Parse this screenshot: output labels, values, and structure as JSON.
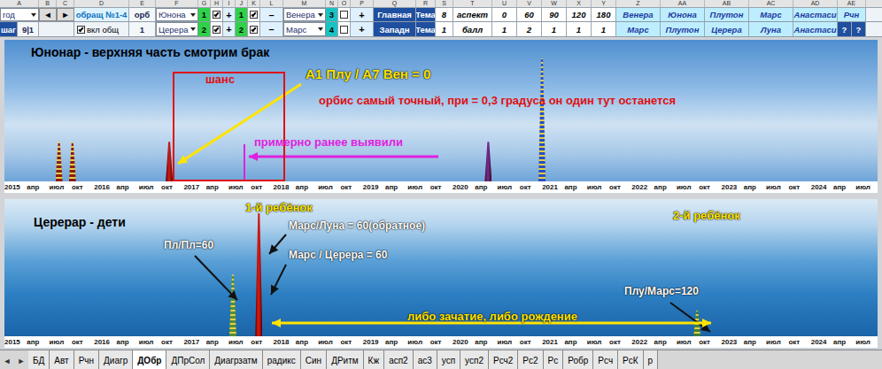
{
  "sheet": {
    "column_letters": [
      "A",
      "B",
      "C",
      "D",
      "E",
      "F",
      "G",
      "H",
      "I",
      "J",
      "K",
      "L",
      "M",
      "N",
      "O",
      "P",
      "Q",
      "R",
      "S",
      "T",
      "U",
      "V",
      "W",
      "X",
      "Y",
      "Z",
      "AA",
      "AB",
      "AC",
      "AD",
      "AE"
    ],
    "rows": [
      [
        {
          "kind": "dropdown",
          "text": "год"
        },
        {
          "kind": "button",
          "text": "◄"
        },
        {
          "kind": "button",
          "text": "►"
        },
        {
          "kind": "accent",
          "text": "обращ №1-4"
        },
        {
          "kind": "label",
          "text": "орб"
        },
        {
          "kind": "dropdown",
          "text": "Юнона"
        },
        {
          "kind": "num",
          "text": "1",
          "color": "#2fd14a"
        },
        {
          "kind": "check",
          "checked": true
        },
        {
          "kind": "sign",
          "text": "+"
        },
        {
          "kind": "num",
          "text": "1",
          "color": "#2fd14a"
        },
        {
          "kind": "check",
          "checked": true
        },
        {
          "kind": "sign",
          "text": "–"
        },
        {
          "kind": "dropdown",
          "text": "Венера"
        },
        {
          "kind": "num",
          "text": "3",
          "color": "#19c3c3"
        },
        {
          "kind": "check",
          "checked": false
        },
        {
          "kind": "sign",
          "text": "+"
        },
        {
          "kind": "head",
          "text": "Главная"
        },
        {
          "kind": "head",
          "text": "Тема"
        },
        {
          "kind": "value",
          "text": "8"
        },
        {
          "kind": "value",
          "text": "аспект"
        },
        {
          "kind": "aspect",
          "text": "0"
        },
        {
          "kind": "aspect",
          "text": "60"
        },
        {
          "kind": "aspect",
          "text": "90"
        },
        {
          "kind": "aspect",
          "text": "120"
        },
        {
          "kind": "aspect",
          "text": "180"
        },
        {
          "kind": "planet",
          "text": "Венера"
        },
        {
          "kind": "planet",
          "text": "Юнона"
        },
        {
          "kind": "planet",
          "text": "Плутон"
        },
        {
          "kind": "planet",
          "text": "Марс"
        },
        {
          "kind": "planet",
          "text": "Анастаси"
        },
        {
          "kind": "planet",
          "text": "Рчн"
        }
      ],
      [
        {
          "kind": "head",
          "text": "шаг"
        },
        {
          "kind": "label",
          "text": "9|1"
        },
        {
          "kind": "blank"
        },
        {
          "kind": "checklabel",
          "text": "вкл общ",
          "checked": true
        },
        {
          "kind": "label",
          "text": "1"
        },
        {
          "kind": "dropdown",
          "text": "Церера"
        },
        {
          "kind": "num",
          "text": "2",
          "color": "#2fd14a"
        },
        {
          "kind": "check",
          "checked": true
        },
        {
          "kind": "sign",
          "text": "+"
        },
        {
          "kind": "num",
          "text": "2",
          "color": "#2fd14a"
        },
        {
          "kind": "check",
          "checked": true
        },
        {
          "kind": "sign",
          "text": "–"
        },
        {
          "kind": "dropdown",
          "text": "Марс"
        },
        {
          "kind": "num",
          "text": "4",
          "color": "#19c3c3"
        },
        {
          "kind": "check",
          "checked": false
        },
        {
          "kind": "sign",
          "text": "+"
        },
        {
          "kind": "head",
          "text": "Западн"
        },
        {
          "kind": "head",
          "text": "Тема"
        },
        {
          "kind": "value",
          "text": "1"
        },
        {
          "kind": "value",
          "text": "балл"
        },
        {
          "kind": "aspect",
          "text": "1"
        },
        {
          "kind": "aspect",
          "text": "2"
        },
        {
          "kind": "aspect",
          "text": "1"
        },
        {
          "kind": "aspect",
          "text": "1"
        },
        {
          "kind": "aspect",
          "text": "1"
        },
        {
          "kind": "planet",
          "text": "Марс"
        },
        {
          "kind": "planet",
          "text": "Плутон"
        },
        {
          "kind": "planet",
          "text": "Церера"
        },
        {
          "kind": "planet",
          "text": "Луна"
        },
        {
          "kind": "planet",
          "text": "Анастаси"
        },
        {
          "kind": "head",
          "text": "?"
        },
        {
          "kind": "head",
          "text": "?"
        }
      ]
    ]
  },
  "charts": [
    {
      "kind": "sky",
      "x_ticks": [
        "2015",
        "апр",
        "июл",
        "окт",
        "2016",
        "апр",
        "июл",
        "окт",
        "2017",
        "апр",
        "июл",
        "окт",
        "2018",
        "апр",
        "июл",
        "окт",
        "2019",
        "апр",
        "июл",
        "окт",
        "2020",
        "апр",
        "июл",
        "окт",
        "2021",
        "апр",
        "июл",
        "окт",
        "2022",
        "апр",
        "июл",
        "окт",
        "2023",
        "апр",
        "июл",
        "окт",
        "2024",
        "апр",
        "июл"
      ],
      "spikes": [
        {
          "date": 2015.53,
          "value": 28,
          "color": "#8e1c14",
          "pattern": "striped"
        },
        {
          "date": 2015.68,
          "value": 28,
          "color": "#8e1c14",
          "pattern": "striped"
        },
        {
          "date": 2016.76,
          "value": 28,
          "color": "#c21a12",
          "pattern": "solid"
        },
        {
          "date": 2020.32,
          "value": 28,
          "color": "#6b2a8f",
          "pattern": "solid"
        },
        {
          "date": 2020.92,
          "value": 87,
          "color": "#2a4fc2",
          "pattern": "striped"
        }
      ],
      "annotations": [
        {
          "text": "Юнонар - верхняя часть смотрим брак",
          "color": "#000000"
        },
        {
          "text": "шанс",
          "color": "#e01010"
        },
        {
          "text": "А1 Плу / А7 Вен = 0",
          "color": "#ffe400"
        },
        {
          "text": "орбис самый точный, при = 0,3 градуса он один тут останется",
          "color": "#e01010"
        },
        {
          "text": "примерно ранее выявили",
          "color": "#e020e0"
        }
      ]
    },
    {
      "kind": "sea",
      "x_ticks": [
        "2015",
        "апр",
        "июл",
        "окт",
        "2016",
        "апр",
        "июл",
        "окт",
        "2017",
        "апр",
        "июл",
        "окт",
        "2018",
        "апр",
        "июл",
        "окт",
        "2019",
        "апр",
        "июл",
        "окт",
        "2020",
        "апр",
        "июл",
        "окт",
        "2021",
        "апр",
        "июл",
        "окт",
        "2022",
        "апр",
        "июл",
        "окт",
        "2023",
        "апр",
        "июл",
        "окт",
        "2024",
        "апр",
        "июл"
      ],
      "spikes": [
        {
          "date": 2017.47,
          "value": 45,
          "color": "#4f8f3a",
          "pattern": "striped"
        },
        {
          "date": 2017.76,
          "value": 90,
          "color": "#d3160e",
          "pattern": "solid"
        },
        {
          "date": 2022.65,
          "value": 19,
          "color": "#3f7f3a",
          "pattern": "striped"
        }
      ],
      "annotations": [
        {
          "text": "Церерар - дети",
          "color": "#000000"
        },
        {
          "text": "1-й ребёнок",
          "color": "#ffe400"
        },
        {
          "text": "2-й ребёнок",
          "color": "#ffe400"
        },
        {
          "text": "Пл/Пл=60",
          "color": "#ffffff"
        },
        {
          "text": "Марс/Луна = 60(обратное)",
          "color": "#ffffff"
        },
        {
          "text": "Марс / Церера = 60",
          "color": "#ffffff"
        },
        {
          "text": "Плу/Марс=120",
          "color": "#ffffff"
        },
        {
          "text": "либо зачатие, либо рождение",
          "color": "#ffe400"
        }
      ]
    }
  ],
  "tabs": {
    "nav": [
      "◄",
      "►"
    ],
    "items": [
      {
        "label": "БД",
        "selected": false
      },
      {
        "label": "Авт",
        "selected": false
      },
      {
        "label": "Рчн",
        "selected": false
      },
      {
        "label": "Диагр",
        "selected": false
      },
      {
        "label": "ДОбр",
        "selected": true
      },
      {
        "label": "ДПрСол",
        "selected": false
      },
      {
        "label": "Диагрзатм",
        "selected": false
      },
      {
        "label": "радикс",
        "selected": false
      },
      {
        "label": "Син",
        "selected": false
      },
      {
        "label": "ДРитм",
        "selected": false
      },
      {
        "label": "Кж",
        "selected": false
      },
      {
        "label": "асп2",
        "selected": false
      },
      {
        "label": "ас3",
        "selected": false
      },
      {
        "label": "усп",
        "selected": false
      },
      {
        "label": "усп2",
        "selected": false
      },
      {
        "label": "Рсч2",
        "selected": false
      },
      {
        "label": "Рс2",
        "selected": false
      },
      {
        "label": "Рс",
        "selected": false
      },
      {
        "label": "Робр",
        "selected": false
      },
      {
        "label": "Рсч",
        "selected": false
      },
      {
        "label": "РсК",
        "selected": false
      },
      {
        "label": "р",
        "selected": false
      }
    ]
  }
}
